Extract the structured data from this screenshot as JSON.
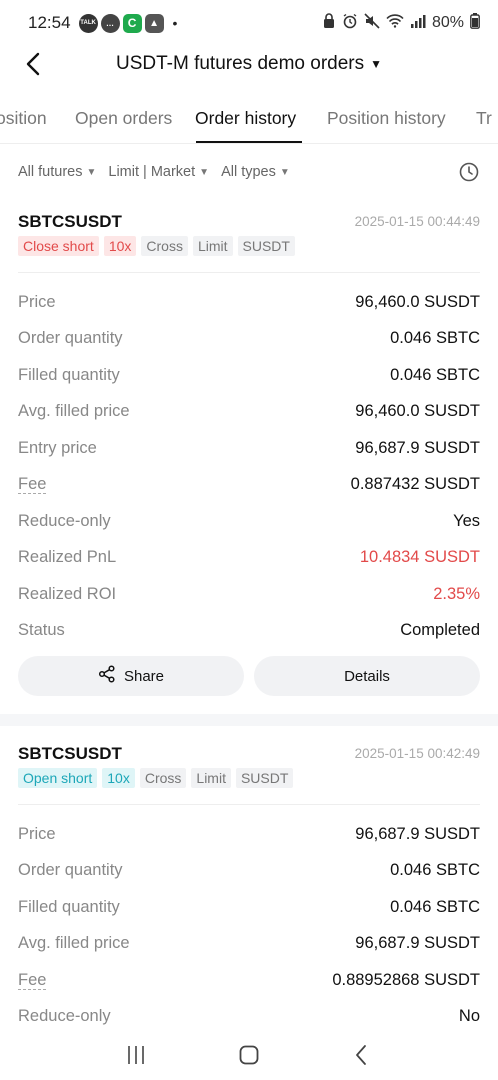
{
  "status_bar": {
    "time": "12:54",
    "battery_percent": "80%"
  },
  "header": {
    "title": "USDT-M futures demo orders"
  },
  "tabs": [
    {
      "label": "osition"
    },
    {
      "label": "Open orders"
    },
    {
      "label": "Order history"
    },
    {
      "label": "Position history"
    },
    {
      "label": "Tr"
    }
  ],
  "filters": {
    "futures": "All futures",
    "order_type": "Limit | Market",
    "types": "All types"
  },
  "orders": [
    {
      "symbol": "SBTCSUSDT",
      "timestamp": "2025-01-15 00:44:49",
      "tags": [
        "Close short",
        "10x",
        "Cross",
        "Limit",
        "SUSDT"
      ],
      "rows": [
        {
          "label": "Price",
          "value": "96,460.0 SUSDT"
        },
        {
          "label": "Order quantity",
          "value": "0.046 SBTC"
        },
        {
          "label": "Filled quantity",
          "value": "0.046 SBTC"
        },
        {
          "label": "Avg. filled price",
          "value": "96,460.0 SUSDT"
        },
        {
          "label": "Entry price",
          "value": "96,687.9 SUSDT"
        },
        {
          "label": "Fee",
          "value": "0.887432 SUSDT"
        },
        {
          "label": "Reduce-only",
          "value": "Yes"
        },
        {
          "label": "Realized PnL",
          "value": "10.4834 SUSDT"
        },
        {
          "label": "Realized ROI",
          "value": "2.35%"
        },
        {
          "label": "Status",
          "value": "Completed"
        }
      ],
      "share_label": "Share",
      "details_label": "Details"
    },
    {
      "symbol": "SBTCSUSDT",
      "timestamp": "2025-01-15 00:42:49",
      "tags": [
        "Open short",
        "10x",
        "Cross",
        "Limit",
        "SUSDT"
      ],
      "rows": [
        {
          "label": "Price",
          "value": "96,687.9 SUSDT"
        },
        {
          "label": "Order quantity",
          "value": "0.046 SBTC"
        },
        {
          "label": "Filled quantity",
          "value": "0.046 SBTC"
        },
        {
          "label": "Avg. filled price",
          "value": "96,687.9 SUSDT"
        },
        {
          "label": "Fee",
          "value": "0.88952868 SUSDT"
        },
        {
          "label": "Reduce-only",
          "value": "No"
        }
      ]
    }
  ],
  "colors": {
    "loss_profit_red": "#e24a4a",
    "close_tag_bg": "#fde6e6",
    "open_tag_bg": "#dff5f7",
    "open_tag_text": "#1da7b8"
  }
}
